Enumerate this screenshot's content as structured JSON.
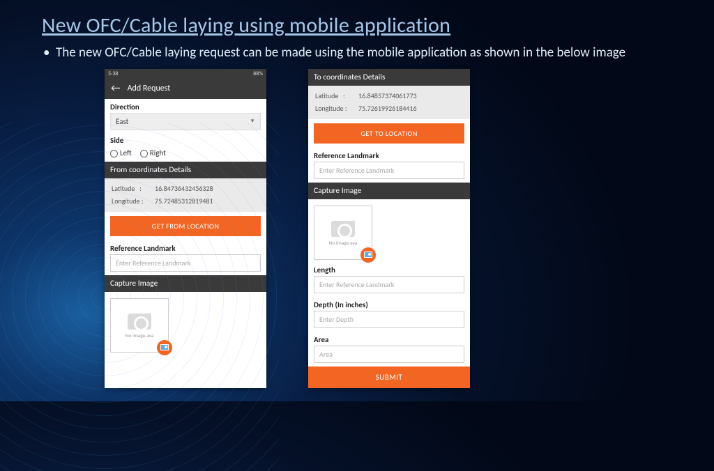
{
  "slide": {
    "title": "New OFC/Cable laying using mobile application",
    "bullet": "The new OFC/Cable laying request can be made using the mobile application as shown in the below image"
  },
  "left": {
    "status_time": "5:38",
    "status_right": "88%",
    "appbar_title": "Add Request",
    "direction_label": "Direction",
    "direction_value": "East",
    "side_label": "Side",
    "side_left": "Left",
    "side_right": "Right",
    "from_header": "From coordinates Details",
    "lat_label": "Latitude",
    "lon_label": "Longitude",
    "lat_value": "16.84736432456328",
    "lon_value": "75.72485312819481",
    "get_from_btn": "GET FROM LOCATION",
    "ref_label": "Reference Landmark",
    "ref_placeholder": "Enter Reference Landmark",
    "capture_header": "Capture Image",
    "no_image": "No image ava"
  },
  "right": {
    "to_header": "To coordinates Details",
    "lat_label": "Latitude",
    "lon_label": "Longitude",
    "lat_value": "16.84857374061773",
    "lon_value": "75.72619926184416",
    "get_to_btn": "GET TO LOCATION",
    "ref_label": "Reference Landmark",
    "ref_placeholder": "Enter Reference Landmark",
    "capture_header": "Capture Image",
    "no_image": "No image ava",
    "length_label": "Length",
    "length_placeholder": "Enter Reference Landmark",
    "depth_label": "Depth (In inches)",
    "depth_placeholder": "Enter Depth",
    "area_label": "Area",
    "area_placeholder": "Area",
    "submit_btn": "SUBMIT"
  }
}
